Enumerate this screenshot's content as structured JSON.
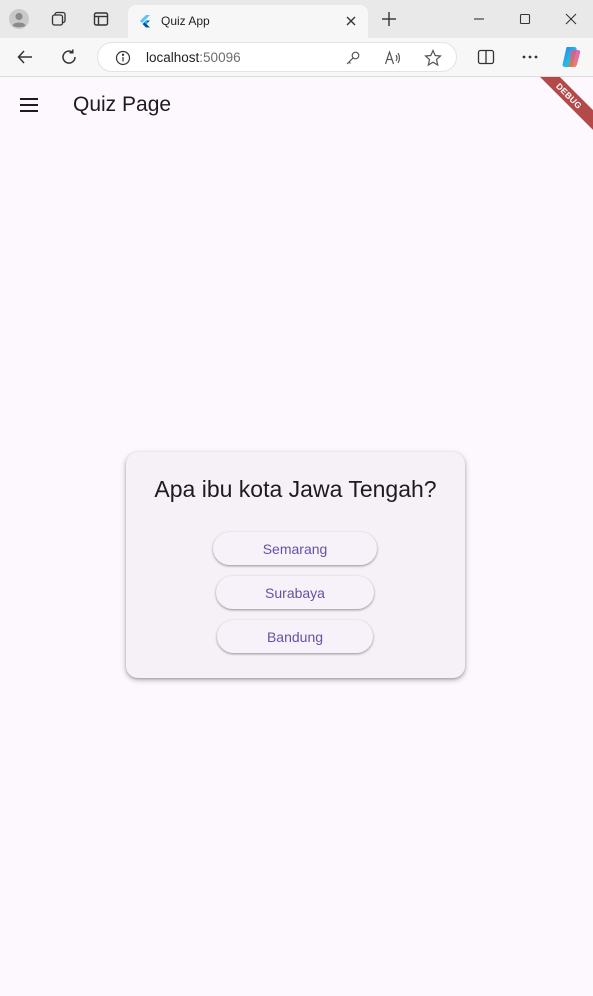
{
  "browser": {
    "tab": {
      "title": "Quiz App",
      "favicon": "flutter-logo-icon"
    },
    "address": {
      "host": "localhost",
      "port": ":50096"
    },
    "icons": {
      "profile": "profile-icon",
      "workspaces": "workspaces-icon",
      "tab_actions": "tab-actions-icon",
      "new_tab": "plus-icon",
      "minimize": "minimize-icon",
      "maximize": "maximize-icon",
      "close": "close-icon",
      "back": "back-arrow-icon",
      "refresh": "refresh-icon",
      "site_info": "info-icon",
      "key": "key-icon",
      "read_aloud": "read-aloud-icon",
      "favorite": "star-icon",
      "split_screen": "split-screen-icon",
      "more": "more-icon",
      "copilot": "copilot-icon"
    }
  },
  "app": {
    "title": "Quiz Page",
    "menu_icon": "hamburger-menu-icon",
    "debug_label": "DEBUG",
    "quiz": {
      "question": "Apa ibu kota Jawa Tengah?",
      "answers": [
        {
          "label": "Semarang"
        },
        {
          "label": "Surabaya"
        },
        {
          "label": "Bandung"
        }
      ]
    }
  },
  "colors": {
    "app_background": "#fdf7fe",
    "card_background": "#f5f1f7",
    "button_text": "#6750a4",
    "debug_banner": "#b4494a",
    "browser_frame": "#e9e9e9"
  }
}
